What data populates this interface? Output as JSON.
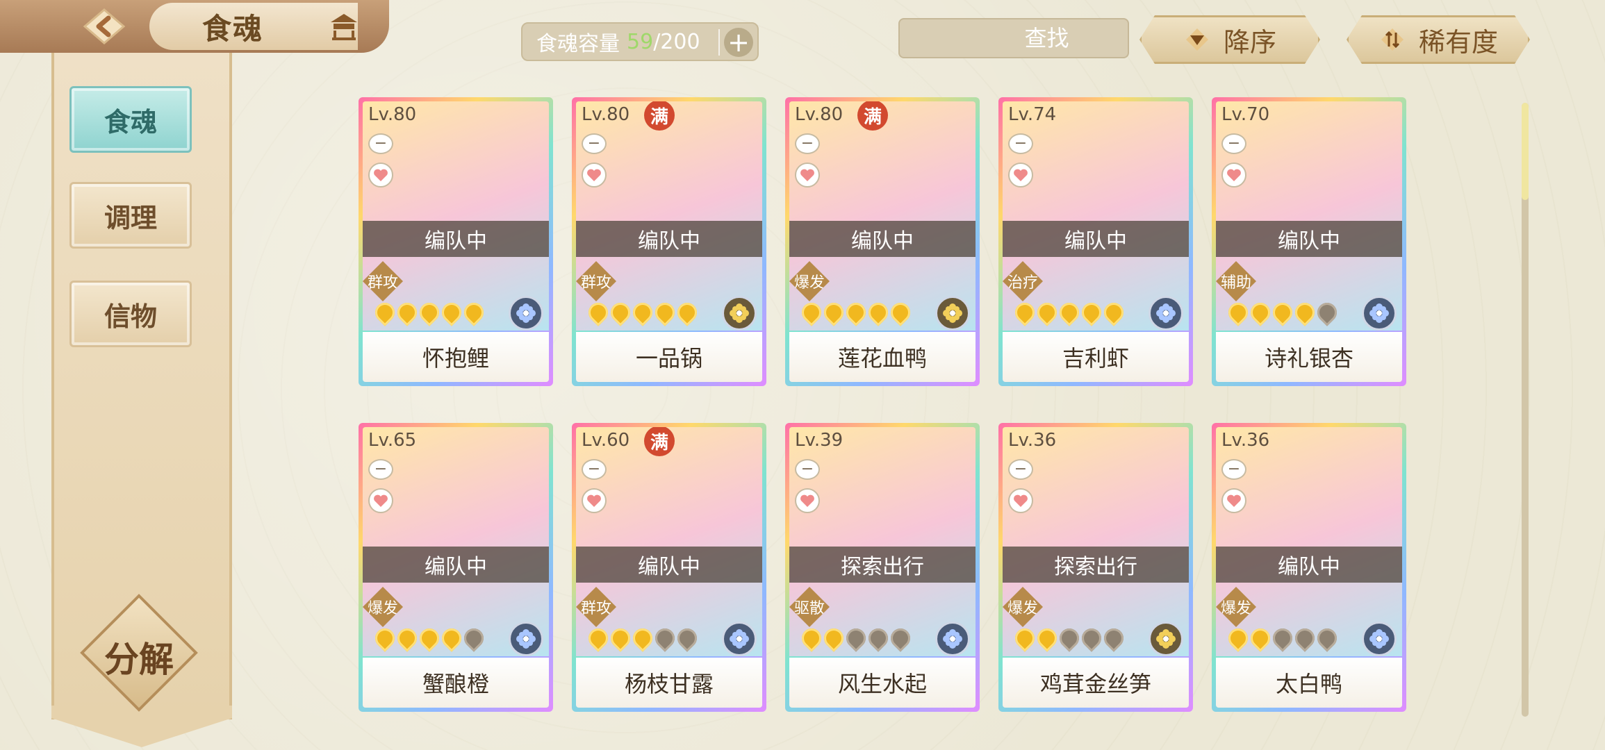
{
  "header": {
    "title": "食魂"
  },
  "capacity": {
    "label": "食魂容量",
    "current": "59",
    "separator": "/",
    "max": "200"
  },
  "search": {
    "placeholder": "查找"
  },
  "sort": {
    "order_label": "降序",
    "rarity_label": "稀有度"
  },
  "sidebar": {
    "tabs": [
      {
        "label": "食魂"
      },
      {
        "label": "调理"
      },
      {
        "label": "信物"
      }
    ],
    "decompose_label": "分解"
  },
  "colors": {
    "capacity_current": "#9fd86a",
    "active_tab": "#8ed3cf",
    "full_badge": "#d2492f"
  },
  "cards": [
    {
      "level": "Lv.80",
      "full": "",
      "status": "编队中",
      "role": "群攻",
      "stars": 5,
      "name": "怀抱鲤",
      "element": "water"
    },
    {
      "level": "Lv.80",
      "full": "满",
      "status": "编队中",
      "role": "群攻",
      "stars": 5,
      "name": "一品锅",
      "element": "gold"
    },
    {
      "level": "Lv.80",
      "full": "满",
      "status": "编队中",
      "role": "爆发",
      "stars": 5,
      "name": "莲花血鸭",
      "element": "gold"
    },
    {
      "level": "Lv.74",
      "full": "",
      "status": "编队中",
      "role": "治疗",
      "stars": 5,
      "name": "吉利虾",
      "element": "water"
    },
    {
      "level": "Lv.70",
      "full": "",
      "status": "编队中",
      "role": "辅助",
      "stars": 4,
      "name": "诗礼银杏",
      "element": "water"
    },
    {
      "level": "Lv.65",
      "full": "",
      "status": "编队中",
      "role": "爆发",
      "stars": 4,
      "name": "蟹酿橙",
      "element": "water"
    },
    {
      "level": "Lv.60",
      "full": "满",
      "status": "编队中",
      "role": "群攻",
      "stars": 3,
      "name": "杨枝甘露",
      "element": "water"
    },
    {
      "level": "Lv.39",
      "full": "",
      "status": "探索出行",
      "role": "驱散",
      "stars": 2,
      "name": "风生水起",
      "element": "water"
    },
    {
      "level": "Lv.36",
      "full": "",
      "status": "探索出行",
      "role": "爆发",
      "stars": 2,
      "name": "鸡茸金丝笋",
      "element": "gold"
    },
    {
      "level": "Lv.36",
      "full": "",
      "status": "编队中",
      "role": "爆发",
      "stars": 2,
      "name": "太白鸭",
      "element": "water"
    }
  ],
  "icons": [
    "back-arrow-icon",
    "crown-icon",
    "plus-icon",
    "search-icon",
    "close-icon",
    "sort-down-icon",
    "sort-toggle-icon",
    "minus-icon",
    "heart-icon",
    "flower-element-icon"
  ]
}
